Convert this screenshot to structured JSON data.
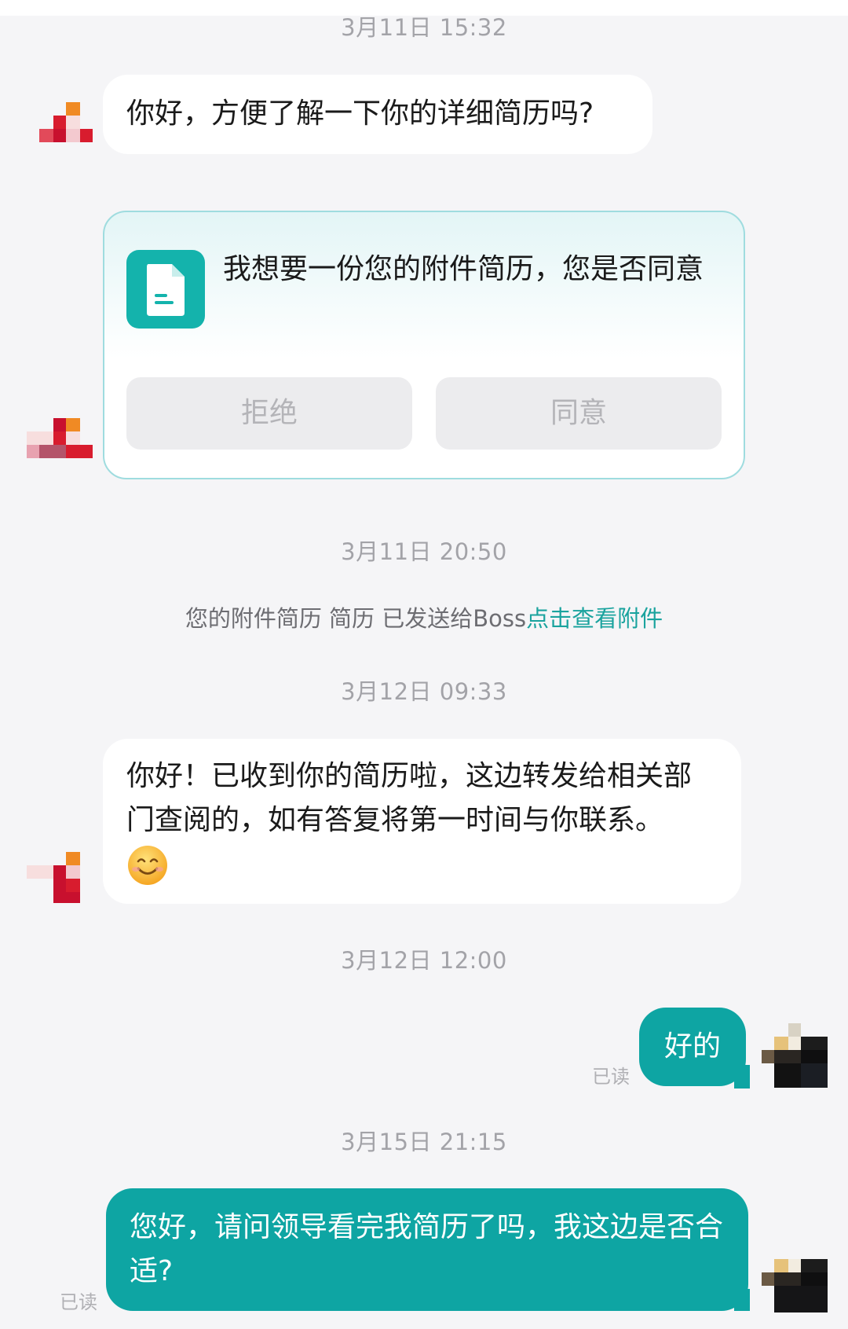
{
  "messages": {
    "ts1": "3月11日 15:32",
    "m1": "你好，方便了解一下你的详细简历吗?",
    "card": {
      "text": "我想要一份您的附件简历，您是否同意",
      "reject": "拒绝",
      "agree": "同意",
      "icon": "document-icon"
    },
    "ts2": "3月11日 20:50",
    "notice": {
      "text": "您的附件简历 简历 已发送给Boss",
      "link": "点击查看附件"
    },
    "ts3": "3月12日 09:33",
    "m2": "你好！已收到你的简历啦，这边转发给相关部门查阅的，如有答复将第一时间与你联系。",
    "m2_emoji": "😊",
    "ts4": "3月12日 12:00",
    "m3": "好的",
    "m3_status": "已读",
    "ts5": "3月15日 21:15",
    "m4": "您好，请问领导看完我简历了吗，我这边是否合适?",
    "m4_status": "已读"
  },
  "colors": {
    "sent_bubble": "#0ea5a3",
    "link": "#1aa39e",
    "card_border": "#9fdcdf",
    "background": "#f5f5f7"
  }
}
